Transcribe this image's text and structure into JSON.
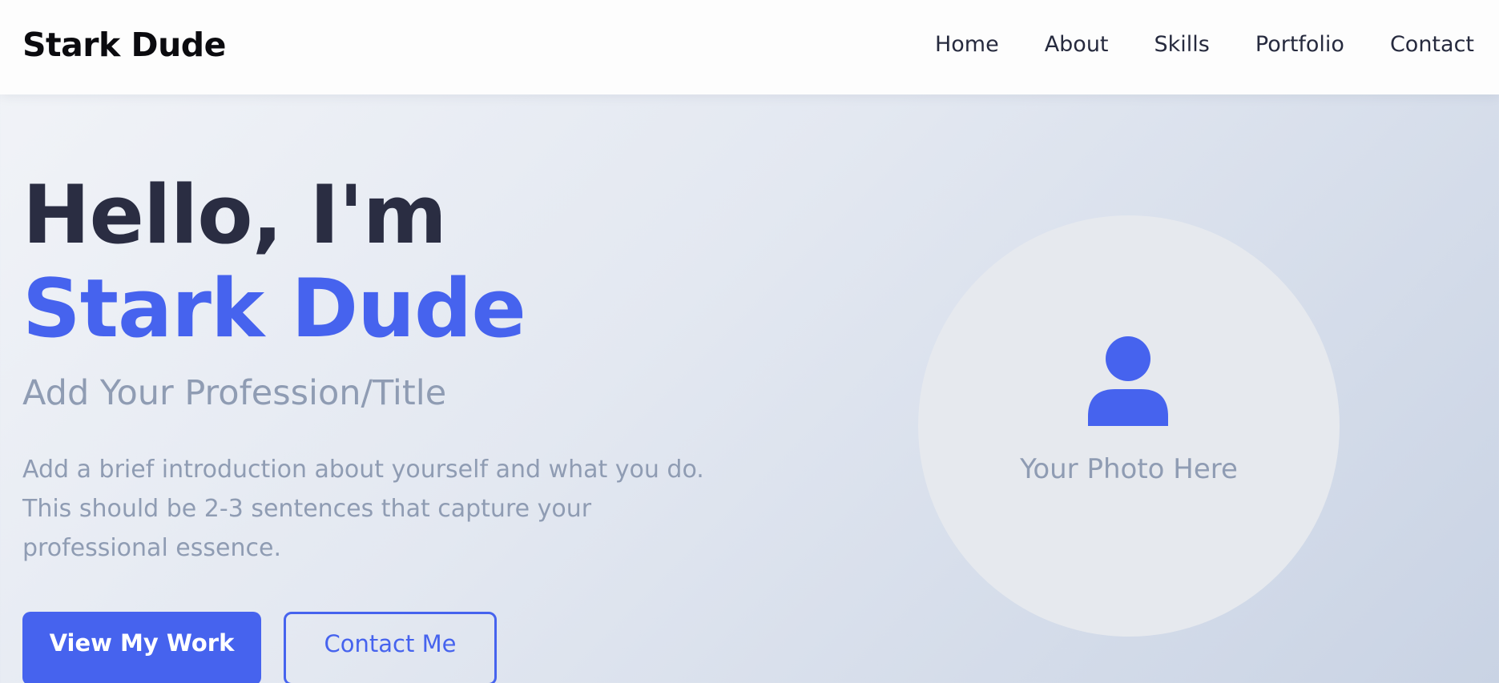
{
  "nav": {
    "brand": "Stark Dude",
    "links": [
      "Home",
      "About",
      "Skills",
      "Portfolio",
      "Contact"
    ]
  },
  "hero": {
    "greeting": "Hello, I'm ",
    "name": "Stark Dude",
    "subtitle": "Add Your Profession/Title",
    "intro": "Add a brief introduction about yourself and what you do. This should be 2-3 sentences that capture your professional essence.",
    "primary_button": "View My Work",
    "secondary_button": "Contact Me"
  },
  "photo": {
    "icon": "user-icon",
    "label": "Your Photo Here"
  },
  "colors": {
    "accent": "#4663ee",
    "heading": "#2a2d42",
    "muted": "#8f9cb3",
    "nav_background": "#fdfdfd"
  }
}
